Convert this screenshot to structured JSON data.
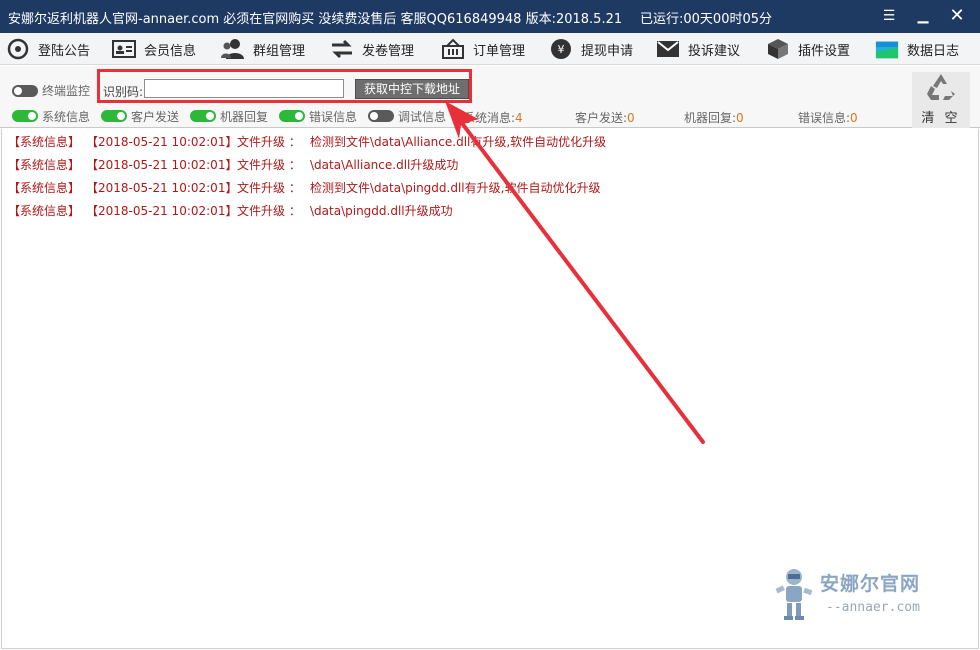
{
  "window": {
    "title": "安娜尔返利机器人官网-annaer.com 必须在官网购买 没续费没售后 客服QQ616849948 版本:2018.5.21",
    "runtime": "已运行:00天00时05分",
    "menu_glyph": "☰",
    "min_glyph": "▁",
    "close_glyph": "✕"
  },
  "menu": [
    {
      "label": "登陆公告",
      "icon": "login-icon"
    },
    {
      "label": "会员信息",
      "icon": "member-card-icon"
    },
    {
      "label": "群组管理",
      "icon": "group-icon"
    },
    {
      "label": "发卷管理",
      "icon": "exchange-arrows-icon"
    },
    {
      "label": "订单管理",
      "icon": "basket-icon"
    },
    {
      "label": "提现申请",
      "icon": "yen-coin-icon"
    },
    {
      "label": "投诉建议",
      "icon": "mail-icon"
    },
    {
      "label": "插件设置",
      "icon": "cube-icon"
    },
    {
      "label": "数据日志",
      "icon": "data-log-icon"
    }
  ],
  "toolbar": {
    "terminal_monitor": "终端监控",
    "id_label": "识别码:",
    "id_value": "",
    "get_button": "获取中控下载地址",
    "clear_label": "清 空"
  },
  "filters": {
    "system_info": "系统信息",
    "customer_send": "客户发送",
    "robot_reply": "机器回复",
    "error_info": "错误信息",
    "debug_info": "调试信息"
  },
  "stats": {
    "system_label": "系统消息:",
    "system_count": "4",
    "customer_label": "客户发送:",
    "customer_count": "0",
    "robot_label": "机器回复:",
    "robot_count": "0",
    "error_label": "错误信息:",
    "error_count": "0"
  },
  "logs": [
    {
      "type": "【系统信息】",
      "time": "【2018-05-21 10:02:01】",
      "category": "文件升级 ：",
      "message": "检测到文件\\data\\Alliance.dll有升级,软件自动优化升级"
    },
    {
      "type": "【系统信息】",
      "time": "【2018-05-21 10:02:01】",
      "category": "文件升级 ：",
      "message": "\\data\\Alliance.dll升级成功"
    },
    {
      "type": "【系统信息】",
      "time": "【2018-05-21 10:02:01】",
      "category": "文件升级 ：",
      "message": "检测到文件\\data\\pingdd.dll有升级,软件自动优化升级"
    },
    {
      "type": "【系统信息】",
      "time": "【2018-05-21 10:02:01】",
      "category": "文件升级 ：",
      "message": "\\data\\pingdd.dll升级成功"
    }
  ],
  "watermark": {
    "name": "安娜尔官网",
    "url": "--annaer.com"
  },
  "colors": {
    "titlebar": "#1e3a63",
    "highlight_box": "#e8303b",
    "log_text": "#b01818",
    "toggle_on": "#2eb83a",
    "count_text": "#d7791f"
  }
}
